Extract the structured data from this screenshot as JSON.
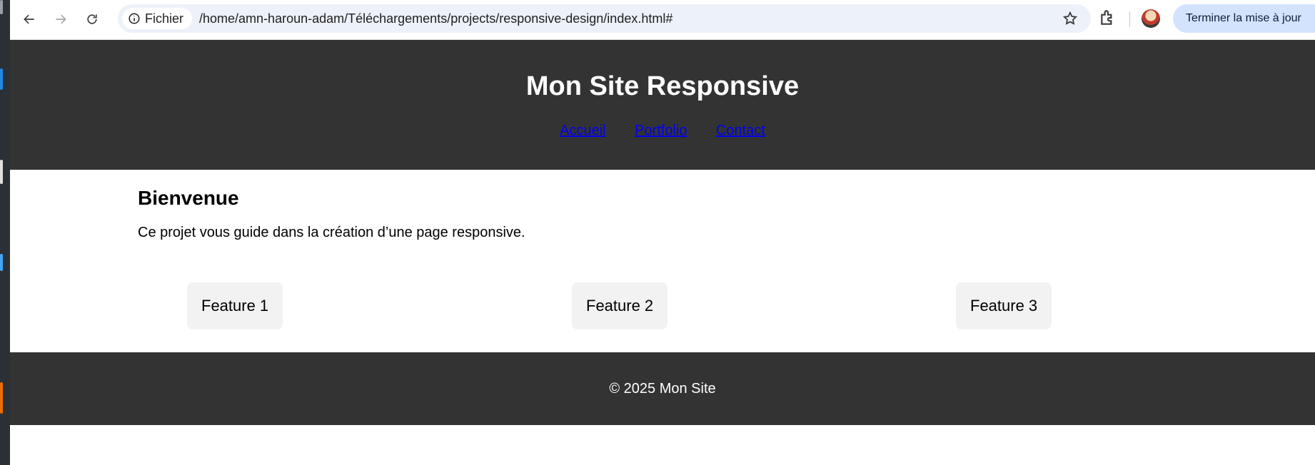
{
  "browser": {
    "security_chip_label": "Fichier",
    "url": "/home/amn-haroun-adam/Téléchargements/projects/responsive-design/index.html#",
    "update_button_label": "Terminer la mise à jour"
  },
  "site": {
    "title": "Mon Site Responsive",
    "nav": [
      "Accueil",
      "Portfolio",
      "Contact"
    ],
    "heading": "Bienvenue",
    "intro": "Ce projet vous guide dans la création d’une page responsive.",
    "features": [
      "Feature 1",
      "Feature 2",
      "Feature 3"
    ],
    "footer": "© 2025 Mon Site"
  },
  "colors": {
    "header_bg": "#333333",
    "link": "#0000ee",
    "feature_bg": "#f2f2f2",
    "update_button_bg": "#d3e3fd"
  }
}
